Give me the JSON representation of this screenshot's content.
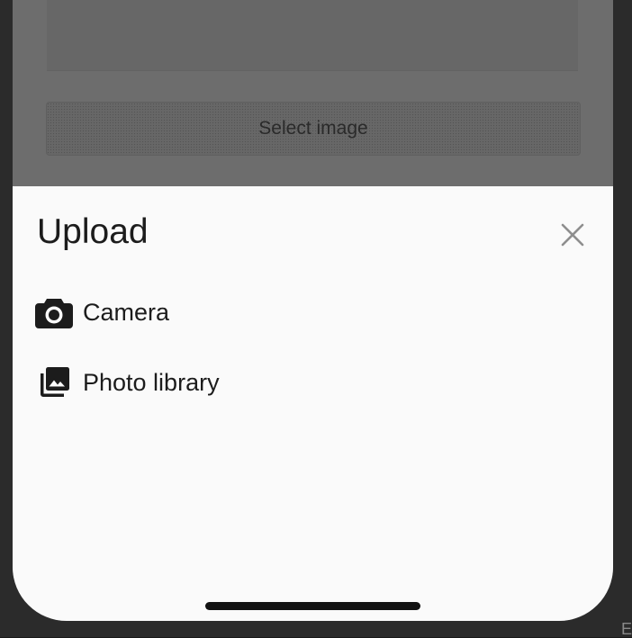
{
  "background_app": {
    "select_button_label": "Select image"
  },
  "sheet": {
    "title": "Upload",
    "options": [
      {
        "label": "Camera",
        "icon": "camera-icon"
      },
      {
        "label": "Photo library",
        "icon": "photo-library-icon"
      }
    ],
    "close_icon": "close-icon"
  },
  "corner_label": "E",
  "colors": {
    "sheet_background": "#fafafa",
    "scrim": "#6d6d6d",
    "text": "#1c1c1c",
    "close_icon": "#8e8e8e"
  }
}
